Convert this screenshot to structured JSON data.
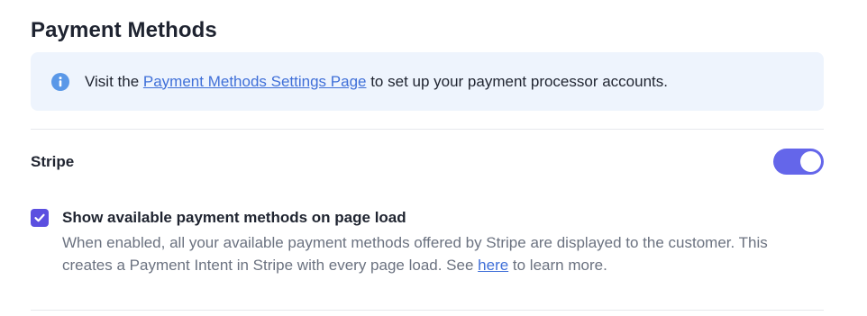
{
  "section": {
    "title": "Payment Methods"
  },
  "notice": {
    "icon": "info-icon",
    "prefix": "Visit the ",
    "link_text": "Payment Methods Settings Page",
    "suffix": " to set up your payment processor accounts."
  },
  "stripe": {
    "label": "Stripe",
    "enabled": true,
    "option": {
      "checked": true,
      "title": "Show available payment methods on page load",
      "description_prefix": "When enabled, all your available payment methods offered by Stripe are displayed to the customer. This creates a Payment Intent in Stripe with every page load. See ",
      "link_text": "here",
      "description_suffix": " to learn more."
    }
  },
  "colors": {
    "accent": "#6466ea",
    "checkbox": "#5b4fe0",
    "link": "#3f6fd8",
    "notice_bg": "#eef4fd",
    "info_icon": "#5a98e8"
  }
}
